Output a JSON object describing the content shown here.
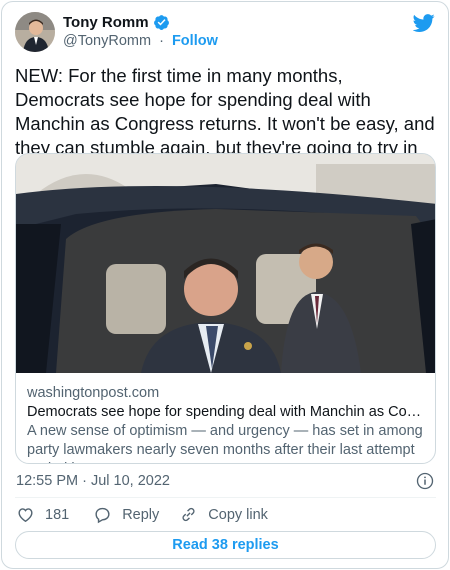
{
  "author": {
    "name": "Tony Romm",
    "handle": "@TonyRomm",
    "separator": "·",
    "follow_label": "Follow"
  },
  "tweet": {
    "text": "NEW: For the first time in many months, Democrats see hope for spending deal with Manchin as Congress returns. It won't be easy, and they can stumble again, but they're going to try in July. Our preview:",
    "timestamp": "12:55 PM · Jul 10, 2022"
  },
  "link_card": {
    "domain": "washingtonpost.com",
    "title": "Democrats see hope for spending deal with Manchin as Congress re...",
    "description": "A new sense of optimism — and urgency — has set in among party lawmakers nearly seven months after their last attempt ended in ..."
  },
  "actions": {
    "like_count": "181",
    "reply_label": "Reply",
    "copy_link_label": "Copy link"
  },
  "read_replies_label": "Read 38 replies",
  "colors": {
    "accent": "#1d9bf0",
    "text_primary": "#0f1419",
    "text_secondary": "#536471",
    "border": "#cfd9de",
    "like_icon": "heart-icon",
    "reply_icon": "speech-bubble-icon",
    "copy_icon": "link-icon"
  }
}
